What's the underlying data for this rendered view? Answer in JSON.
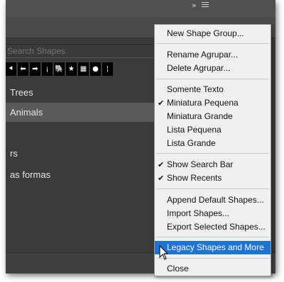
{
  "panel": {
    "search_placeholder": "Search Shapes",
    "recent_shapes": [
      "⯇",
      "⬅",
      "➡",
      "¡",
      "🐘",
      "★",
      "▦",
      "●",
      "¦"
    ],
    "recent_shape_names": [
      "arrow-left-shape",
      "arrow-left-bold-shape",
      "arrow-right-shape",
      "exclamation-shape",
      "elephant-shape",
      "star-shape",
      "grid-shape",
      "ellipse-shape",
      "bar-shape"
    ],
    "groups": [
      "Trees",
      "Animals",
      "",
      "rs",
      "as formas"
    ]
  },
  "menu": {
    "new_shape_group": "New Shape Group...",
    "rename_group": "Rename Agrupar...",
    "delete_group": "Delete Agrupar...",
    "text_only": "Somente Texto",
    "small_thumbnail": "Miniatura Pequena",
    "large_thumbnail": "Miniatura Grande",
    "small_list": "Lista Pequena",
    "large_list": "Lista Grande",
    "show_search_bar": "Show Search Bar",
    "show_recents": "Show Recents",
    "append_default_shapes": "Append Default Shapes...",
    "import_shapes": "Import Shapes...",
    "export_selected_shapes": "Export Selected Shapes...",
    "legacy_shapes": "Legacy Shapes and More",
    "close": "Close",
    "check_mark": "✔"
  },
  "colors": {
    "panel_bg": "#3b3b3b",
    "menu_bg": "#f0f0f0",
    "highlight": "#1e74d6"
  }
}
